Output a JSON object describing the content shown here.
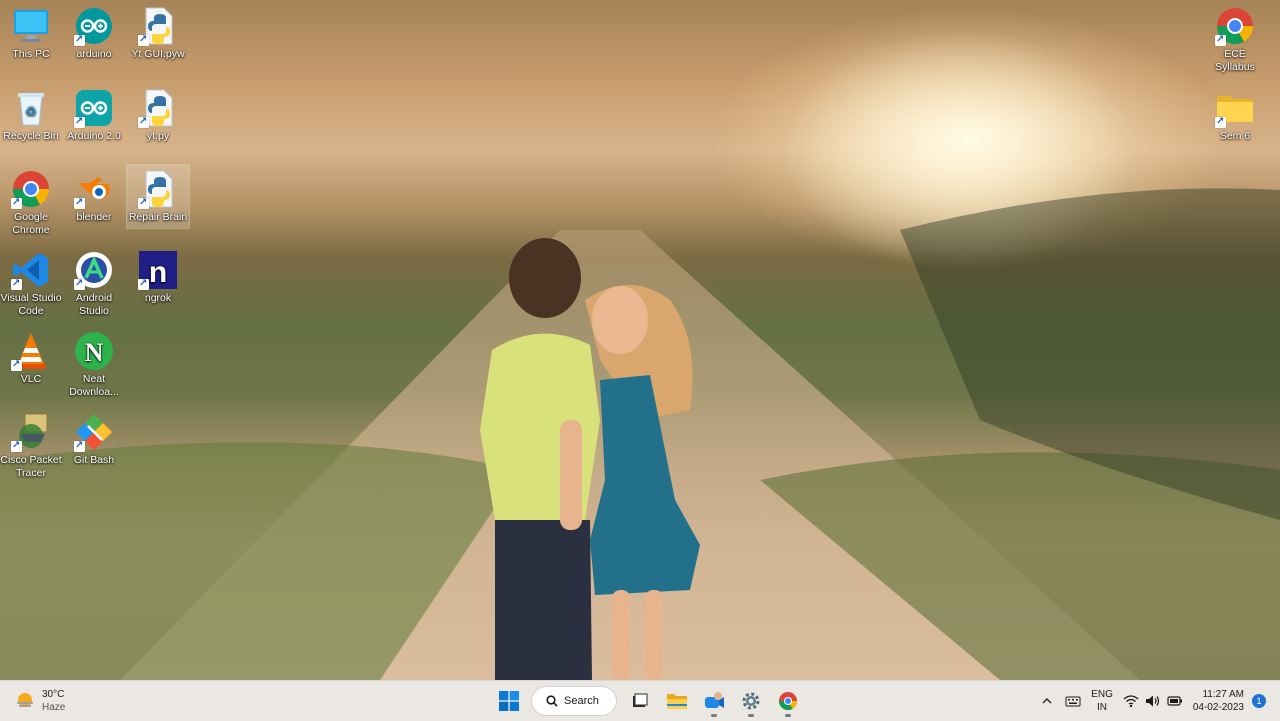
{
  "desktop": {
    "icons": [
      {
        "label": "This PC",
        "icon": "computer-icon"
      },
      {
        "label": "arduino",
        "icon": "arduino-icon"
      },
      {
        "label": "Yt GUI.pyw",
        "icon": "python-file-icon"
      },
      {
        "label": "Recycle Bin",
        "icon": "recycle-bin-icon"
      },
      {
        "label": "Arduino 2.0",
        "icon": "arduino-icon"
      },
      {
        "label": "yt.py",
        "icon": "python-file-icon"
      },
      {
        "label": "Google Chrome",
        "icon": "chrome-icon"
      },
      {
        "label": "blender",
        "icon": "blender-icon"
      },
      {
        "label": "Repair Brain",
        "icon": "python-file-icon"
      },
      {
        "label": "Visual Studio Code",
        "icon": "vscode-icon"
      },
      {
        "label": "Android Studio",
        "icon": "android-studio-icon"
      },
      {
        "label": "ngrok",
        "icon": "ngrok-icon"
      },
      {
        "label": "VLC",
        "icon": "vlc-icon"
      },
      {
        "label": "Neat Downloa...",
        "icon": "neat-download-icon"
      },
      {
        "label": "Cisco Packet Tracer",
        "icon": "packet-tracer-icon"
      },
      {
        "label": "Git Bash",
        "icon": "git-bash-icon"
      },
      {
        "label": "ECE Syllabus",
        "icon": "chrome-icon"
      },
      {
        "label": "Sem 6",
        "icon": "folder-icon"
      }
    ]
  },
  "taskbar": {
    "weather": {
      "temp": "30°C",
      "condition": "Haze"
    },
    "search_label": "Search",
    "lang_line1": "ENG",
    "lang_line2": "IN",
    "time": "11:27 AM",
    "date": "04-02-2023",
    "notification_count": "1"
  },
  "colors": {
    "accent": "#1e73d2",
    "taskbar_bg": "#f0ece8"
  }
}
